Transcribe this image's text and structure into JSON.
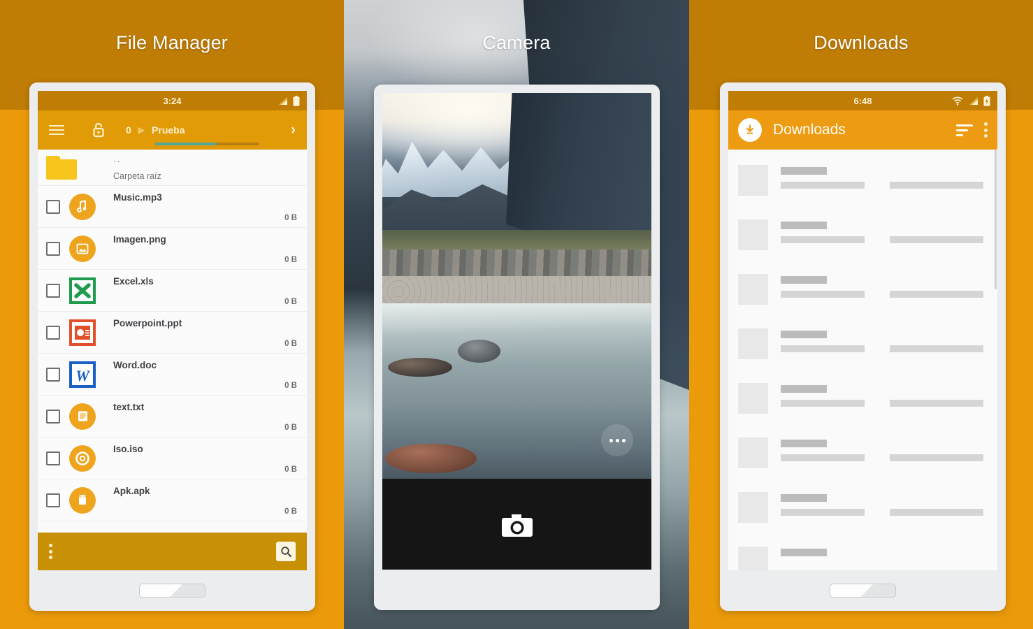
{
  "panels": {
    "file_manager": {
      "heading": "File Manager"
    },
    "camera": {
      "heading": "Camera"
    },
    "downloads": {
      "heading": "Downloads"
    }
  },
  "file_manager": {
    "status_bar": {
      "time": "3:24",
      "signal_icon": "signal-icon",
      "battery_icon": "battery-icon"
    },
    "toolbar": {
      "menu_icon": "hamburger-menu-icon",
      "lock_icon": "unlocked-padlock-icon",
      "count": "0",
      "separator": "▶",
      "path": "Prueba",
      "forward_icon": "chevron-right-icon",
      "progress_percent": 59
    },
    "parent_row": {
      "name": "..",
      "subtitle": "Carpeta raíz",
      "icon": "folder-icon"
    },
    "files": [
      {
        "name": "Music.mp3",
        "size": "0 B",
        "icon": "music-note-icon"
      },
      {
        "name": "Imagen.png",
        "size": "0 B",
        "icon": "image-icon"
      },
      {
        "name": "Excel.xls",
        "size": "0 B",
        "icon": "excel-icon"
      },
      {
        "name": "Powerpoint.ppt",
        "size": "0 B",
        "icon": "powerpoint-icon"
      },
      {
        "name": "Word.doc",
        "size": "0 B",
        "icon": "word-icon"
      },
      {
        "name": "text.txt",
        "size": "0 B",
        "icon": "text-document-icon"
      },
      {
        "name": "Iso.iso",
        "size": "0 B",
        "icon": "disc-icon"
      },
      {
        "name": "Apk.apk",
        "size": "0 B",
        "icon": "android-icon"
      }
    ],
    "bottom_bar": {
      "overflow_icon": "more-vertical-icon",
      "search_icon": "search-icon"
    }
  },
  "camera": {
    "options_icon": "more-horizontal-icon",
    "shutter_icon": "camera-icon"
  },
  "downloads": {
    "status_bar": {
      "time": "6:48",
      "wifi_icon": "wifi-icon",
      "signal_icon": "signal-icon",
      "battery_icon": "battery-charging-icon"
    },
    "toolbar": {
      "badge_icon": "download-icon",
      "title": "Downloads",
      "sort_icon": "sort-icon",
      "overflow_icon": "more-vertical-icon"
    },
    "placeholder_rows": 8
  },
  "colors": {
    "background_top": "#c07d05",
    "background_bottom": "#eb9a0a",
    "file_manager_toolbar": "#e09b07",
    "downloads_toolbar": "#ed9b12",
    "accent_icon": "#efa41d",
    "progress_fill": "#53a69b"
  }
}
